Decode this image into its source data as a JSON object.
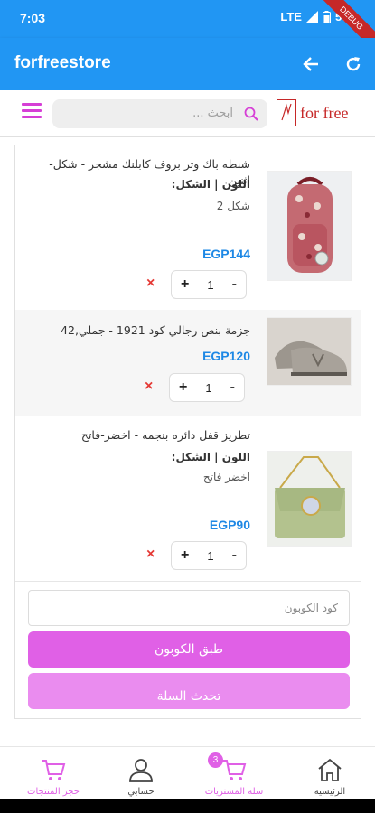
{
  "status_bar": {
    "time": "7:03",
    "network": "LTE",
    "battery": "57%",
    "debug_label": "DEBUG"
  },
  "app_bar": {
    "title": "forfreestore"
  },
  "search": {
    "placeholder": "ابحث ...",
    "logo_text": "for free"
  },
  "cart_items": [
    {
      "title": "شنطه باك وتر بروف كابلنك مشجر - شكل-اثنين",
      "attr_label": "اللون | الشكل:",
      "attr_value": "شكل 2",
      "price": "EGP144",
      "quantity": "1",
      "image": "floral-backpack"
    },
    {
      "title": "جزمة بنص رجالي كود 1921 - جملي,42",
      "price": "EGP120",
      "quantity": "1",
      "image": "grey-suede-loafers"
    },
    {
      "title": "تطريز قفل دائره بنجمه - اخضر-فاتح",
      "attr_label": "اللون | الشكل:",
      "attr_value": "اخضر فاتح",
      "price": "EGP90",
      "quantity": "1",
      "image": "green-embroidered-bag"
    }
  ],
  "controls": {
    "minus": "-",
    "plus": "+",
    "remove": "×"
  },
  "coupon": {
    "placeholder": "كود الكوبون",
    "apply_label": "طبق الكوبون",
    "update_label": "تحدث السلة"
  },
  "bottom_nav": {
    "items": [
      {
        "label": "حجز المنتجات",
        "icon": "cart-icon",
        "active": true
      },
      {
        "label": "حسابي",
        "icon": "user-icon",
        "active": false
      },
      {
        "label": "سلة المشتريات",
        "icon": "cart-icon",
        "active": true,
        "badge": "3"
      },
      {
        "label": "الرئيسية",
        "icon": "home-icon",
        "active": false
      }
    ]
  },
  "colors": {
    "primary": "#2196f3",
    "accent": "#e060e6",
    "price": "#1e88e5",
    "remove": "#e53935"
  }
}
